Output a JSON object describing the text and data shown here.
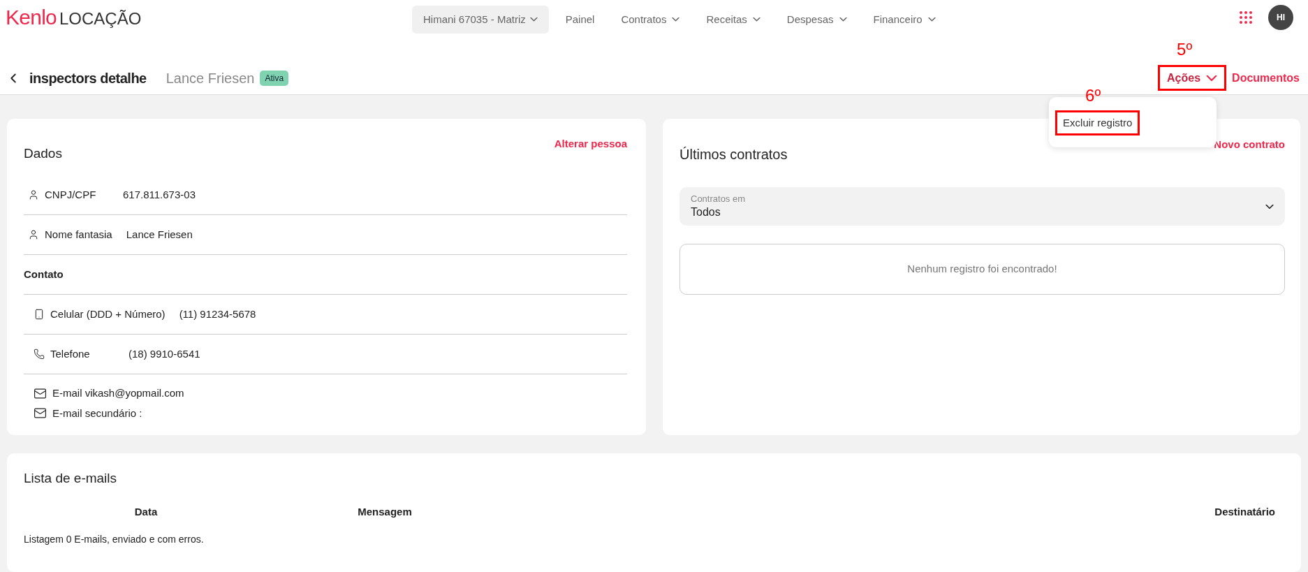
{
  "header": {
    "logo": {
      "brand": "Kenlo",
      "product": "LOCAÇÃO"
    },
    "branch_selector": "Himani 67035 - Matriz",
    "nav": [
      {
        "label": "Painel",
        "has_menu": false
      },
      {
        "label": "Contratos",
        "has_menu": true
      },
      {
        "label": "Receitas",
        "has_menu": true
      },
      {
        "label": "Despesas",
        "has_menu": true
      },
      {
        "label": "Financeiro",
        "has_menu": true
      }
    ],
    "avatar": "HI"
  },
  "page_header": {
    "title": "inspectors detalhe",
    "subtitle": "Lance Friesen",
    "status": "Ativa",
    "actions": {
      "label": "Ações",
      "annotation": "5º",
      "expanded": true,
      "menu": [
        {
          "label": "Excluir registro",
          "annotation": "6º"
        }
      ]
    },
    "documents": "Documentos"
  },
  "data_card": {
    "title": "Dados",
    "action": "Alterar pessoa",
    "rows": [
      {
        "kind": "person",
        "label": "CNPJ/CPF",
        "value": "617.811.673-03"
      },
      {
        "kind": "person",
        "label": "Nome fantasia",
        "value": "Lance Friesen"
      },
      {
        "kind": "section",
        "label": "Contato"
      },
      {
        "kind": "mobile",
        "label": "Celular (DDD + Número)",
        "value": "(11) 91234-5678"
      },
      {
        "kind": "phone",
        "label": "Telefone",
        "value": "(18) 9910-6541"
      }
    ],
    "emails": [
      "E-mail vikash@yopmail.com",
      "E-mail secundário :"
    ]
  },
  "contracts_card": {
    "title": "Últimos contratos",
    "action": "Novo contrato",
    "filter": {
      "label": "Contratos em",
      "value": "Todos"
    },
    "empty": "Nenhum registro foi encontrado!"
  },
  "emails_card": {
    "title": "Lista de e-mails",
    "columns": [
      "Data",
      "Mensagem",
      "Destinatário"
    ],
    "footer": "Listagem 0 E-mails, enviado e com erros."
  }
}
